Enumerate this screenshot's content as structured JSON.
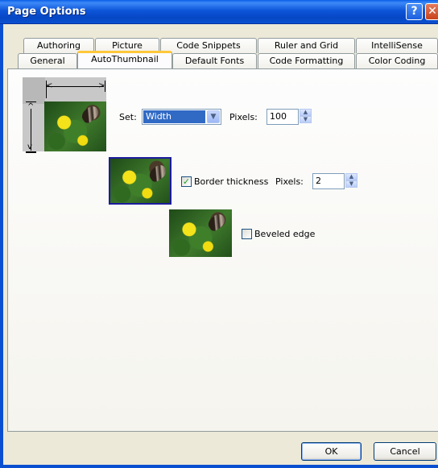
{
  "window": {
    "title": "Page Options",
    "help_label": "?",
    "close_label": "✕"
  },
  "tabs_top": [
    "Authoring",
    "Picture",
    "Code Snippets",
    "Ruler and Grid",
    "IntelliSense"
  ],
  "tabs_bottom": [
    "General",
    "AutoThumbnail",
    "Default Fonts",
    "Code Formatting",
    "Color Coding"
  ],
  "active_tab": "AutoThumbnail",
  "set_row": {
    "label": "Set:",
    "select_value": "Width",
    "pixels_label": "Pixels:",
    "pixels_value": "100"
  },
  "border_row": {
    "checked": true,
    "label": "Border thickness",
    "pixels_label": "Pixels:",
    "pixels_value": "2"
  },
  "bevel_row": {
    "checked": false,
    "label": "Beveled edge"
  },
  "buttons": {
    "ok": "OK",
    "cancel": "Cancel"
  },
  "icons": [
    "help-icon",
    "close-icon",
    "dropdown-arrow-icon",
    "spin-up-icon",
    "spin-down-icon",
    "checkmark-icon"
  ]
}
